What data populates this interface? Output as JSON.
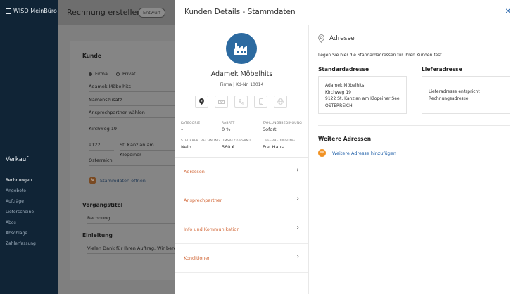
{
  "app": {
    "logo": "WISO MeinBüro",
    "section": "Verkauf",
    "nav": [
      "Rechnungen",
      "Angebote",
      "Aufträge",
      "Lieferscheine",
      "Abos",
      "Abschläge",
      "Zahlerfassung"
    ]
  },
  "main": {
    "title": "Rechnung erstellen",
    "badge": "Entwurf",
    "kunde_label": "Kunde",
    "radio_firma": "Firma",
    "radio_privat": "Privat",
    "company": "Adamek Möbelhits",
    "namenszusatz": "Namenszusatz",
    "ansprechpartner": "Ansprechpartner wählen",
    "street": "Kirchweg 19",
    "zip": "9122",
    "city": "St. Kanzian am Klopeiner",
    "country": "Österreich",
    "stammdaten_btn": "Stammdaten öffnen",
    "vorgangstitel_label": "Vorgangstitel",
    "vorgangstitel_value": "Rechnung",
    "einleitung_label": "Einleitung",
    "einleitung_value": "Vielen Dank für Ihren Auftrag. Wir berechnen"
  },
  "panel": {
    "title": "Kunden Details - Stammdaten",
    "customer_name": "Adamek Möbelhits",
    "customer_sub": "Firma | Kd-Nr. 10014",
    "details": [
      {
        "key": "KATEGORIE",
        "value": "–"
      },
      {
        "key": "RABATT",
        "value": "0 %"
      },
      {
        "key": "ZAHLUNGSBEDINGUNG",
        "value": "Sofort"
      },
      {
        "key": "STEUERFR. RECHNUNG",
        "value": "Nein"
      },
      {
        "key": "UMSATZ GESAMT",
        "value": "560 €"
      },
      {
        "key": "LIEFERBEDINGUNG",
        "value": "Frei Haus"
      }
    ],
    "menu": [
      "Adressen",
      "Ansprechpartner",
      "Info und Kommunikation",
      "Konditionen"
    ],
    "address": {
      "heading": "Adresse",
      "description": "Legen Sie hier die Standardadressen für Ihren Kunden fest.",
      "standard_label": "Standardadresse",
      "standard_lines": [
        "Adamek Möbelhits",
        "Kirchweg 19",
        "9122 St. Kanzian am Klopeiner See",
        "ÖSTERREICH"
      ],
      "liefer_label": "Lieferadresse",
      "liefer_lines": [
        "Lieferadresse entspricht",
        "Rechnungsadresse"
      ],
      "weitere_label": "Weitere Adressen",
      "add_link": "Weitere Adresse hinzufügen"
    }
  },
  "colors": {
    "accent": "#d2693a",
    "link": "#1f5fa8",
    "plus": "#f19223",
    "avatar": "#2c6aa0",
    "sidebar": "#102436"
  }
}
